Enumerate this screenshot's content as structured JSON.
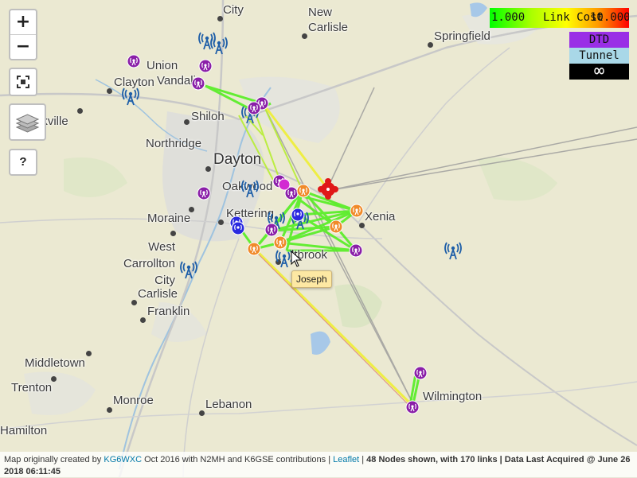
{
  "controls": {
    "zoom_in": "+",
    "zoom_out": "−",
    "help": "?"
  },
  "places": [
    {
      "key": "new_carlisle",
      "label": "New Carlisle"
    },
    {
      "key": "springfield",
      "label": "Springfield"
    },
    {
      "key": "union",
      "label": "Union"
    },
    {
      "key": "clayton",
      "label": "Clayton"
    },
    {
      "key": "vandalia",
      "label": "Vandali"
    },
    {
      "key": "brookville",
      "label": "okville"
    },
    {
      "key": "shiloh",
      "label": "Shiloh"
    },
    {
      "key": "northridge",
      "label": "Northridge"
    },
    {
      "key": "dayton",
      "label": "Dayton"
    },
    {
      "key": "oakwood",
      "label": "Oakwood"
    },
    {
      "key": "xenia",
      "label": "Xenia"
    },
    {
      "key": "kettering",
      "label": "Kettering"
    },
    {
      "key": "moraine",
      "label": "Moraine"
    },
    {
      "key": "west_carrollton",
      "label": "West Carrollton City"
    },
    {
      "key": "beavercreek",
      "label": "ltbrook"
    },
    {
      "key": "carlisle",
      "label": "Carlisle"
    },
    {
      "key": "franklin",
      "label": "Franklin"
    },
    {
      "key": "middletown",
      "label": "Middletown"
    },
    {
      "key": "trenton",
      "label": "Trenton"
    },
    {
      "key": "monroe",
      "label": "Monroe"
    },
    {
      "key": "lebanon",
      "label": "Lebanon"
    },
    {
      "key": "wilmington",
      "label": "Wilmington"
    },
    {
      "key": "hamilton",
      "label": "Hamilton"
    },
    {
      "key": "top_city",
      "label": "City"
    }
  ],
  "legend": {
    "link_cost_min": "1.000",
    "link_cost_label": "Link Cost",
    "link_cost_max": "10.000",
    "dtd": "DTD",
    "tunnel": "Tunnel",
    "infinity": "∞",
    "colors": {
      "dtd": "#9a2ee6",
      "tunnel": "#a9d8e8",
      "infinity_bg": "#000000"
    }
  },
  "tooltip": {
    "text": "Joseph"
  },
  "attribution": {
    "prefix": "Map originally created by",
    "author_link": "KG6WXC",
    "middle": "Oct 2016 with N2MH and K6GSE contributions |",
    "leaflet_link": "Leaflet",
    "separator": "|",
    "stats": "48 Nodes shown, with 170 links",
    "acquired": "| Data Last Acquired @ June 26 2018 06:11:45"
  },
  "node_colors": {
    "purple": "#8a1fa8",
    "orange": "#f08a2a",
    "blue_tower": "#1f5fa8",
    "red_node": "#e01818"
  },
  "link_colors": {
    "good": "#55ee22",
    "mid": "#ccee33",
    "yellow": "#eeee44",
    "tunnel": "#9a9a9a"
  }
}
